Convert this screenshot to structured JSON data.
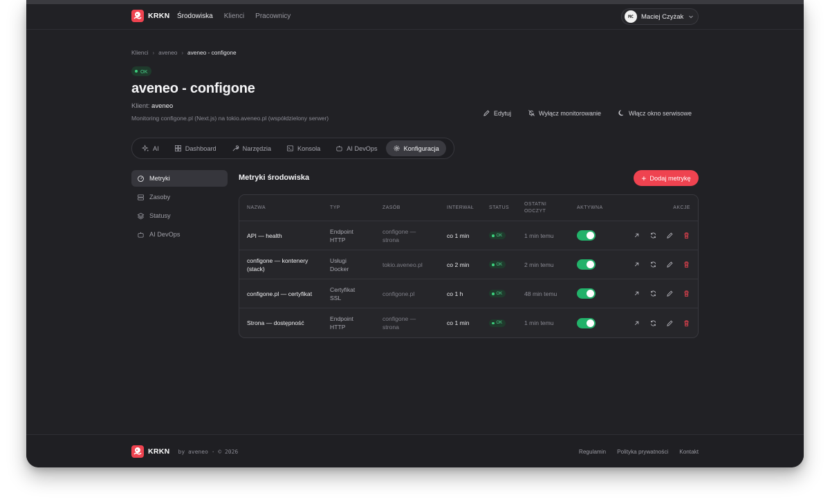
{
  "app": {
    "brand": "KRKN"
  },
  "nav": {
    "items": [
      "Środowiska",
      "Klienci",
      "Pracownicy"
    ],
    "active_index": 0
  },
  "user": {
    "initials": "MC",
    "name": "Maciej Czyżak"
  },
  "breadcrumb": [
    "Klienci",
    "aveneo",
    "aveneo - configone"
  ],
  "status_pill": "OK",
  "page": {
    "title": "aveneo - configone",
    "client_label": "Klient:",
    "client_name": "aveneo",
    "description": "Monitoring configone.pl (Next.js) na tokio.aveneo.pl (współdzielony serwer)"
  },
  "page_actions": {
    "edit": "Edytuj",
    "disable_monitoring": "Wyłącz monitorowanie",
    "enable_service": "Włącz okno serwisowe"
  },
  "tabs": [
    {
      "label": "AI",
      "icon": "sparkles-icon"
    },
    {
      "label": "Dashboard",
      "icon": "dashboard-icon"
    },
    {
      "label": "Narzędzia",
      "icon": "wrench-icon"
    },
    {
      "label": "Konsola",
      "icon": "terminal-icon"
    },
    {
      "label": "AI DevOps",
      "icon": "robot-icon"
    },
    {
      "label": "Konfiguracja",
      "icon": "gear-icon",
      "active": true
    }
  ],
  "sidebar": {
    "items": [
      {
        "label": "Metryki",
        "icon": "gauge-icon",
        "active": true
      },
      {
        "label": "Zasoby",
        "icon": "server-icon"
      },
      {
        "label": "Statusy",
        "icon": "layers-icon"
      },
      {
        "label": "AI DevOps",
        "icon": "robot-icon"
      }
    ]
  },
  "metrics": {
    "title": "Metryki środowiska",
    "add_button": "Dodaj metrykę",
    "columns": {
      "name": "NAZWA",
      "type": "TYP",
      "resource": "ZASÓB",
      "interval": "INTERWAŁ",
      "status": "STATUS",
      "last_read_1": "OSTATNI",
      "last_read_2": "ODCZYT",
      "active": "AKTYWNA",
      "actions": "AKCJE"
    },
    "rows": [
      {
        "name": "API — health",
        "type_1": "Endpoint",
        "type_2": "HTTP",
        "resource_1": "configone —",
        "resource_2": "strona",
        "interval": "co 1 min",
        "status": "OK",
        "last": "1 min temu",
        "active": true
      },
      {
        "name": "configone — kontenery",
        "name_2": "(stack)",
        "type_1": "Usługi",
        "type_2": "Docker",
        "resource_1": "tokio.aveneo.pl",
        "resource_2": "",
        "interval": "co 2 min",
        "status": "OK",
        "last": "2 min temu",
        "active": true
      },
      {
        "name": "configone.pl — certyfikat",
        "type_1": "Certyfikat",
        "type_2": "SSL",
        "resource_1": "configone.pl",
        "resource_2": "",
        "interval": "co 1 h",
        "status": "OK",
        "last": "48 min temu",
        "active": true
      },
      {
        "name": "Strona — dostępność",
        "type_1": "Endpoint",
        "type_2": "HTTP",
        "resource_1": "configone —",
        "resource_2": "strona",
        "interval": "co 1 min",
        "status": "OK",
        "last": "1 min temu",
        "active": true
      }
    ]
  },
  "footer": {
    "brand": "KRKN",
    "byline": "by aveneo · © 2026",
    "links": [
      "Regulamin",
      "Polityka prywatności",
      "Kontakt"
    ]
  },
  "colors": {
    "accent": "#ef4350",
    "ok": "#3ccf7d",
    "toggle_on": "#22b26a",
    "background": "#212125"
  }
}
